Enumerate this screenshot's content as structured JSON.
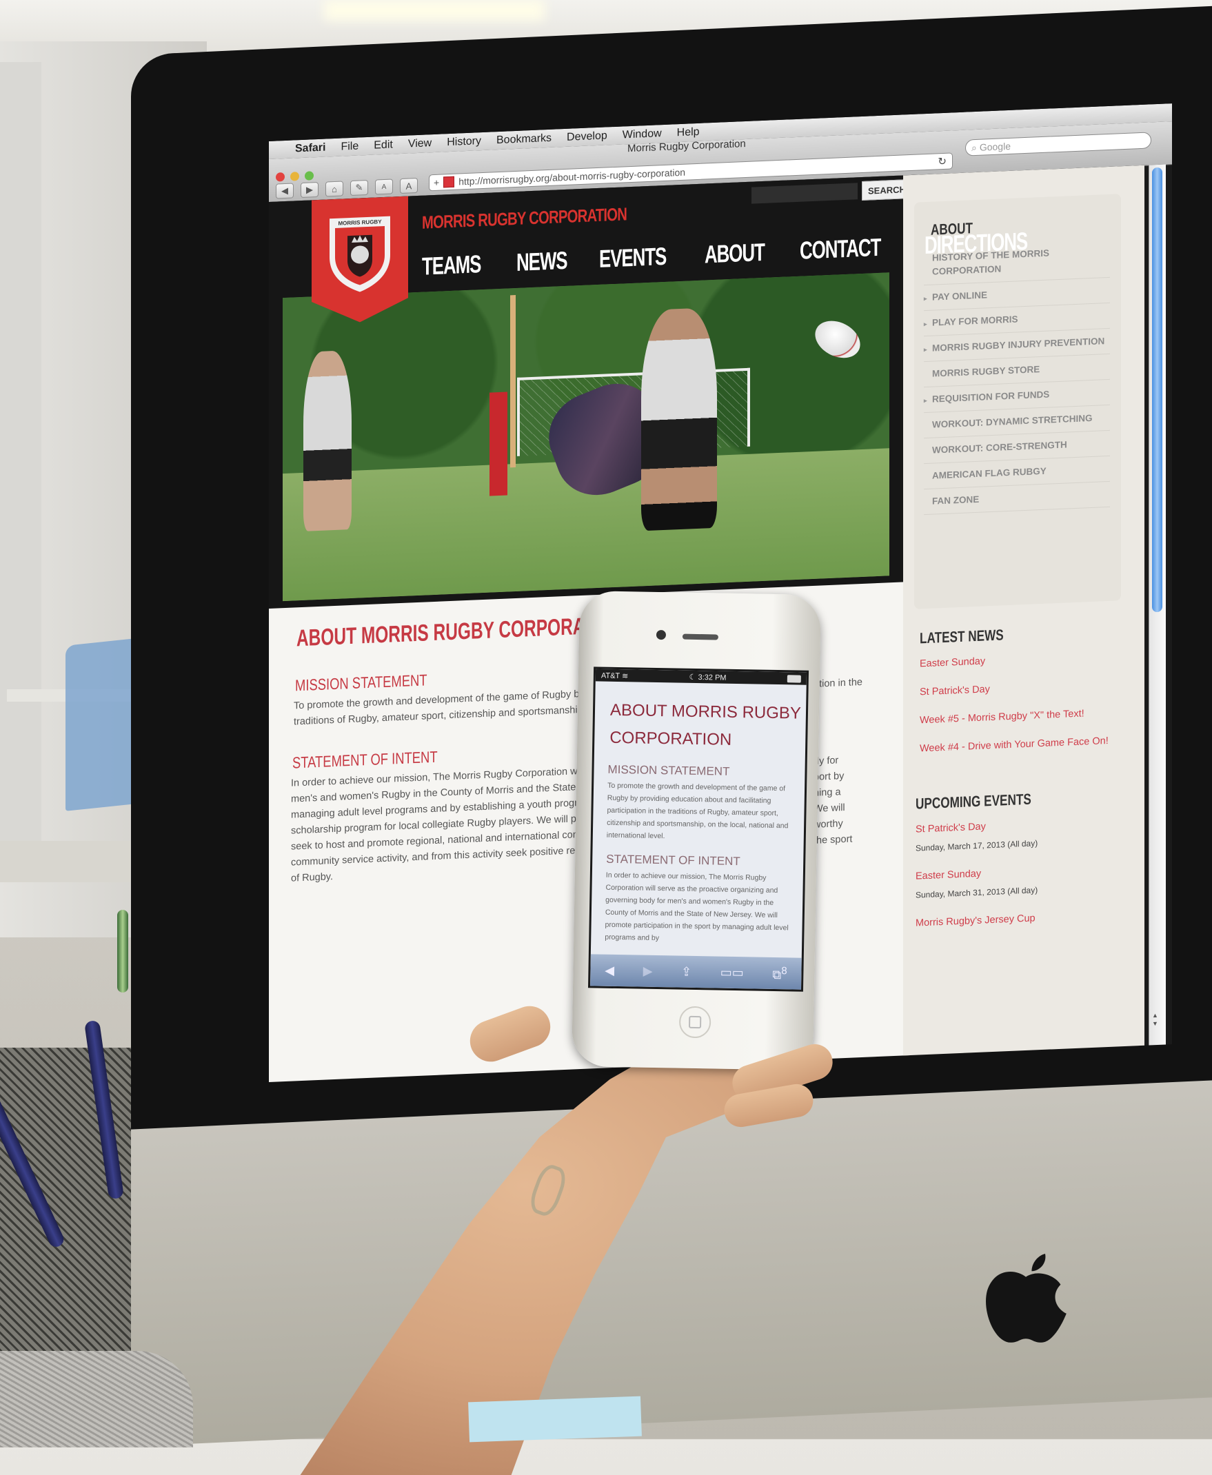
{
  "scene": {
    "description": "Photo of an iMac showing Safari with the Morris Rugby Corporation website, with a hand holding an iPhone displaying the mobile version",
    "colors": {
      "brand_red": "#d8332f",
      "heading_red": "#c63a44",
      "link_red": "#cf3d4a",
      "header_black": "#161616"
    }
  },
  "mac_menu": {
    "apple_icon": "apple-icon",
    "items": [
      "Safari",
      "File",
      "Edit",
      "View",
      "History",
      "Bookmarks",
      "Develop",
      "Window",
      "Help"
    ]
  },
  "browser": {
    "window_title": "Morris Rugby Corporation",
    "url": "http://morrisrugby.org/about-morris-rugby-corporation",
    "search_placeholder": "Google",
    "buttons": {
      "back": "◀",
      "forward": "▶",
      "home": "⌂",
      "edit": "✎",
      "text_smaller": "A",
      "text_bigger": "A",
      "add_bookmark": "+",
      "reload": "↻",
      "search_icon": "🔍"
    }
  },
  "site": {
    "search_button": "SEARCH",
    "title": "MORRIS RUGBY CORPORATION",
    "crest_text": "MORRIS RUGBY",
    "nav": [
      "TEAMS",
      "NEWS",
      "EVENTS",
      "ABOUT",
      "CONTACT",
      "DIRECTIONS"
    ],
    "hero_alt": "Rugby players in action on a field; player passing a Gilbert ball",
    "page_heading": "ABOUT MORRIS RUGBY CORPORATION",
    "mission_heading": "MISSION STATEMENT",
    "mission_lines": [
      "To promote the growth and development of the game of Rugby by",
      "traditions of Rugby, amateur sport, citizenship and sportsmanship, o"
    ],
    "mission_right_fragment": "ation in the",
    "intent_heading": "STATEMENT OF INTENT",
    "intent_lines": [
      "In order to achieve our mission, The Morris Rugby Corporation will s",
      "men's and women's Rugby in the County of Morris and the State of",
      "managing adult level programs and by establishing a youth program",
      "scholarship program for local collegiate Rugby players. We will prov",
      "seek to host and promote regional, national and international comp",
      "community service activity, and from this activity seek positive reco",
      "of Rugby."
    ],
    "intent_right_fragments": [
      "dy for",
      "port by",
      "hing a",
      "We will",
      "worthy",
      "the sport"
    ],
    "sidebar": {
      "heading": "ABOUT",
      "items": [
        {
          "label": "HISTORY OF THE MORRIS CORPORATION",
          "has_arrow": false
        },
        {
          "label": "PAY ONLINE",
          "has_arrow": true
        },
        {
          "label": "PLAY FOR MORRIS",
          "has_arrow": true
        },
        {
          "label": "MORRIS RUGBY INJURY PREVENTION",
          "has_arrow": true
        },
        {
          "label": "MORRIS RUGBY STORE",
          "has_arrow": false
        },
        {
          "label": "REQUISITION FOR FUNDS",
          "has_arrow": true
        },
        {
          "label": "WORKOUT: DYNAMIC STRETCHING",
          "has_arrow": false
        },
        {
          "label": "WORKOUT: CORE-STRENGTH",
          "has_arrow": false
        },
        {
          "label": "AMERICAN FLAG RUBGY",
          "has_arrow": false
        },
        {
          "label": "FAN ZONE",
          "has_arrow": false
        }
      ],
      "arrow_glyph": "▸"
    },
    "latest_news": {
      "heading": "LATEST NEWS",
      "items": [
        "Easter Sunday",
        "St Patrick's Day",
        "Week #5 - Morris Rugby \"X\" the Text!",
        "Week #4 - Drive with Your Game Face On!"
      ]
    },
    "upcoming_events": {
      "heading": "UPCOMING EVENTS",
      "items": [
        {
          "title": "St Patrick's Day",
          "date": "Sunday, March 17, 2013 (All day)"
        },
        {
          "title": "Easter Sunday",
          "date": "Sunday, March 31, 2013 (All day)"
        },
        {
          "title": "Morris Rugby's Jersey Cup",
          "date": ""
        }
      ]
    },
    "scroll_position": 0.0,
    "scroll_visible_fraction": 0.52
  },
  "phone": {
    "status": {
      "carrier": "AT&T",
      "wifi_icon": "wifi-icon",
      "time": "3:32 PM",
      "moon_icon": "☾",
      "battery_icon": "battery-icon"
    },
    "heading_lines": [
      "ABOUT MORRIS RUGBY",
      "CORPORATION"
    ],
    "mission_heading": "MISSION STATEMENT",
    "mission_text": "To promote the growth and development of the game of Rugby by providing education about and facilitating participation in the traditions of Rugby, amateur sport, citizenship and sportsmanship, on the local, national and international level.",
    "intent_heading": "STATEMENT OF INTENT",
    "intent_text": "In order to achieve our mission, The Morris Rugby Corporation will serve as the proactive organizing and governing body for men's and women's Rugby in the County of Morris and the State of New Jersey. We will promote participation in the sport by managing adult level programs and by",
    "toolbar": {
      "back": "◀",
      "forward": "▶",
      "share": "⇪",
      "bookmarks": "📖",
      "tabs": "⧉",
      "tab_count": "8"
    }
  }
}
